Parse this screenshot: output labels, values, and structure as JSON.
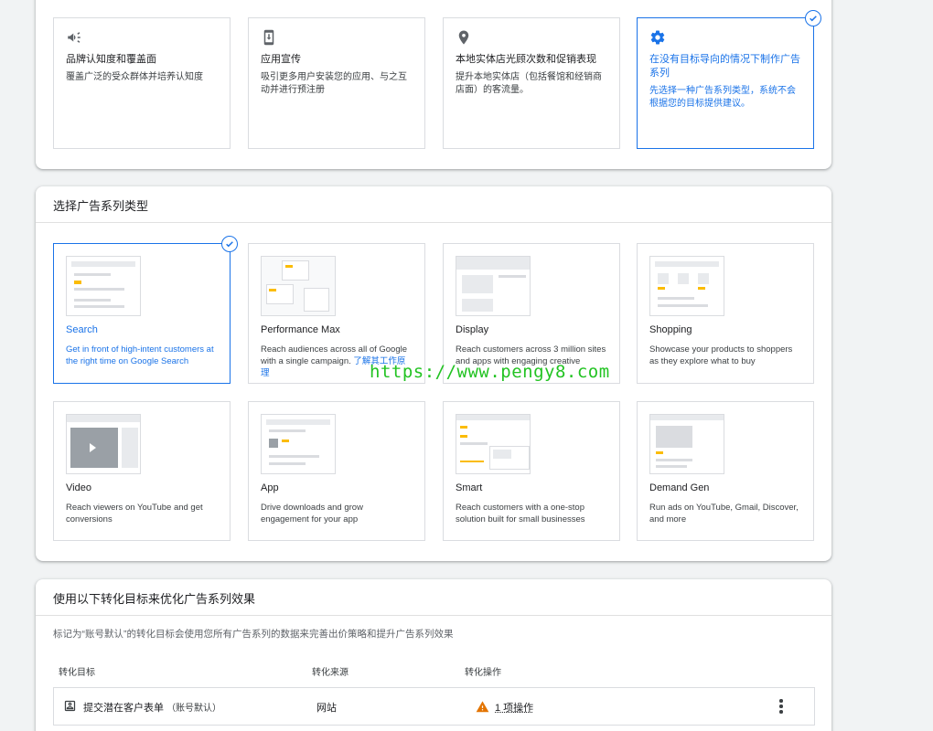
{
  "goals": [
    {
      "title": "品牌认知度和覆盖面",
      "desc": "覆盖广泛的受众群体并培养认知度",
      "icon": "megaphone-icon"
    },
    {
      "title": "应用宣传",
      "desc": "吸引更多用户安装您的应用、与之互动并进行预注册",
      "icon": "phone-download-icon"
    },
    {
      "title": "本地实体店光顾次数和促销表现",
      "desc": "提升本地实体店（包括餐馆和经销商店面）的客流量。",
      "icon": "location-pin-icon"
    },
    {
      "title": "在没有目标导向的情况下制作广告系列",
      "desc": "先选择一种广告系列类型，系统不会根据您的目标提供建议。",
      "icon": "gear-icon",
      "selected": true
    }
  ],
  "campaign_types": {
    "header": "选择广告系列类型",
    "items": [
      {
        "title": "Search",
        "desc": "Get in front of high-intent customers at the right time on Google Search",
        "selected": true
      },
      {
        "title": "Performance Max",
        "desc": "Reach audiences across all of Google with a single campaign.",
        "link": "了解其工作原理"
      },
      {
        "title": "Display",
        "desc": "Reach customers across 3 million sites and apps with engaging creative"
      },
      {
        "title": "Shopping",
        "desc": "Showcase your products to shoppers as they explore what to buy"
      },
      {
        "title": "Video",
        "desc": "Reach viewers on YouTube and get conversions"
      },
      {
        "title": "App",
        "desc": "Drive downloads and grow engagement for your app"
      },
      {
        "title": "Smart",
        "desc": "Reach customers with a one-stop solution built for small businesses"
      },
      {
        "title": "Demand Gen",
        "desc": "Run ads on YouTube, Gmail, Discover, and more"
      }
    ]
  },
  "watermark": "https://www.pengy8.com",
  "conversion": {
    "header": "使用以下转化目标来优化广告系列效果",
    "desc": "标记为“账号默认”的转化目标会使用您所有广告系列的数据来完善出价策略和提升广告系列效果",
    "columns": [
      "转化目标",
      "转化来源",
      "转化操作"
    ],
    "row": {
      "goal": "提交潜在客户表单",
      "tag": "（账号默认）",
      "source": "网站",
      "action": "1 项操作"
    }
  },
  "colors": {
    "accent": "#1a73e8",
    "warning": "#e37400",
    "highlight": "#fbbc04"
  }
}
